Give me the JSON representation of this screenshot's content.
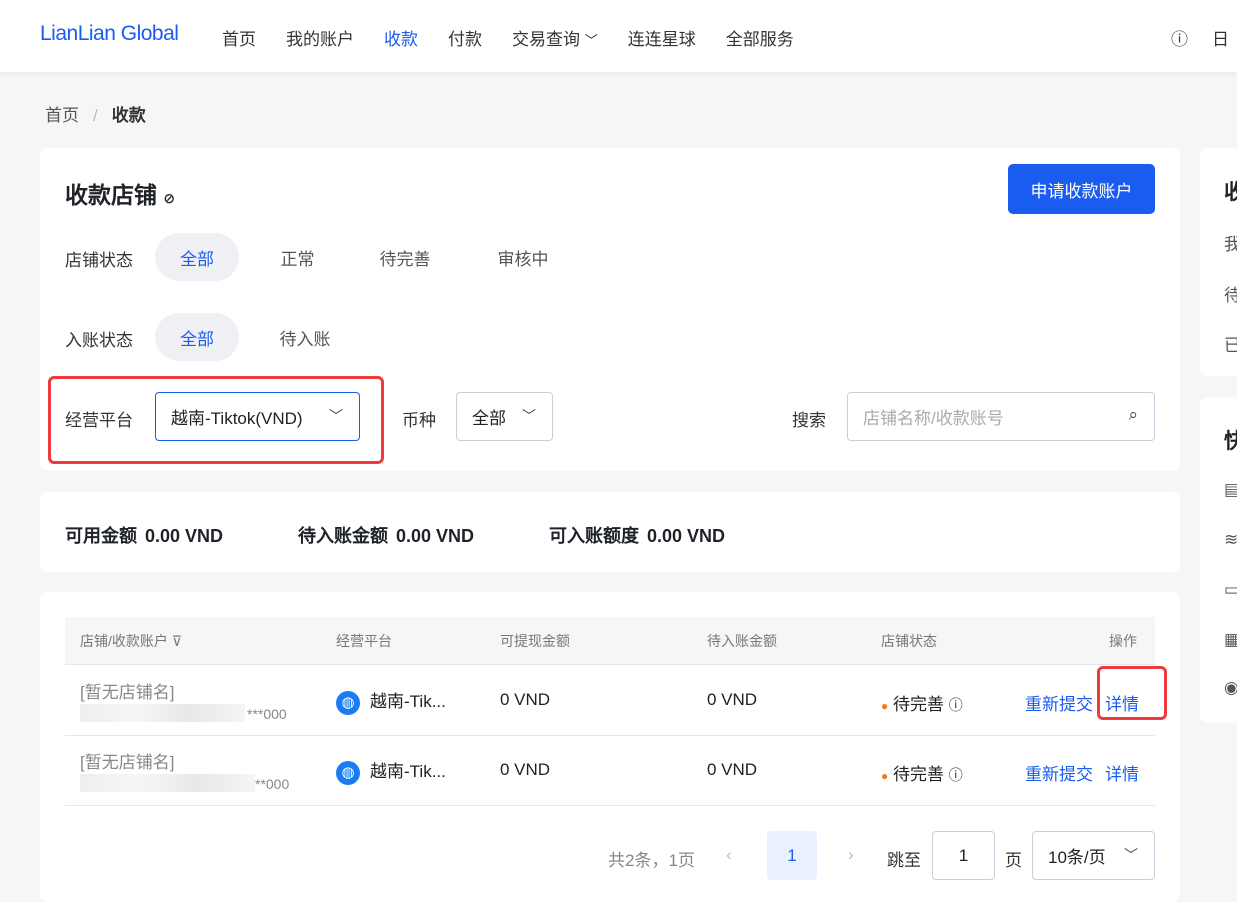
{
  "header": {
    "logo": "LianLian Global",
    "nav": [
      "首页",
      "我的账户",
      "收款",
      "付款",
      "交易查询",
      "连连星球",
      "全部服务"
    ],
    "active": "收款",
    "accent": "#1a5cf0"
  },
  "breadcrumb": {
    "home": "首页",
    "current": "收款"
  },
  "filters": {
    "title": "收款店铺",
    "apply_button": "申请收款账户",
    "shop_status_label": "店铺状态",
    "shop_status_options": [
      "全部",
      "正常",
      "待完善",
      "审核中"
    ],
    "entry_status_label": "入账状态",
    "entry_status_options": [
      "全部",
      "待入账"
    ],
    "platform_label": "经营平台",
    "platform_value": "越南-Tiktok(VND)",
    "currency_label": "币种",
    "currency_value": "全部",
    "search_label": "搜索",
    "search_placeholder": "店铺名称/收款账号"
  },
  "summary": [
    {
      "label": "可用金额",
      "value": "0.00 VND"
    },
    {
      "label": "待入账金额",
      "value": "0.00 VND"
    },
    {
      "label": "可入账额度",
      "value": "0.00 VND"
    }
  ],
  "table": {
    "headers": [
      "店铺/收款账户",
      "经营平台",
      "可提现金额",
      "待入账金额",
      "店铺状态",
      "操作"
    ],
    "rows": [
      {
        "shop": "[暂无店铺名]",
        "account": "***000",
        "platform": "越南-Tik...",
        "withdrawable": "0 VND",
        "pending": "0 VND",
        "status": "待完善",
        "action1": "重新提交",
        "action2": "详情"
      },
      {
        "shop": "[暂无店铺名]",
        "account": "**000",
        "platform": "越南-Tik...",
        "withdrawable": "0 VND",
        "pending": "0 VND",
        "status": "待完善",
        "action1": "重新提交",
        "action2": "详情"
      }
    ]
  },
  "pagination": {
    "total": "共2条，1页",
    "current": "1",
    "jump_label": "跳至",
    "jump_value": "1",
    "page_unit": "页",
    "page_size": "10条/页"
  },
  "side": {
    "title1": "收",
    "items1": [
      "我",
      "待",
      "已"
    ],
    "title2": "快"
  }
}
